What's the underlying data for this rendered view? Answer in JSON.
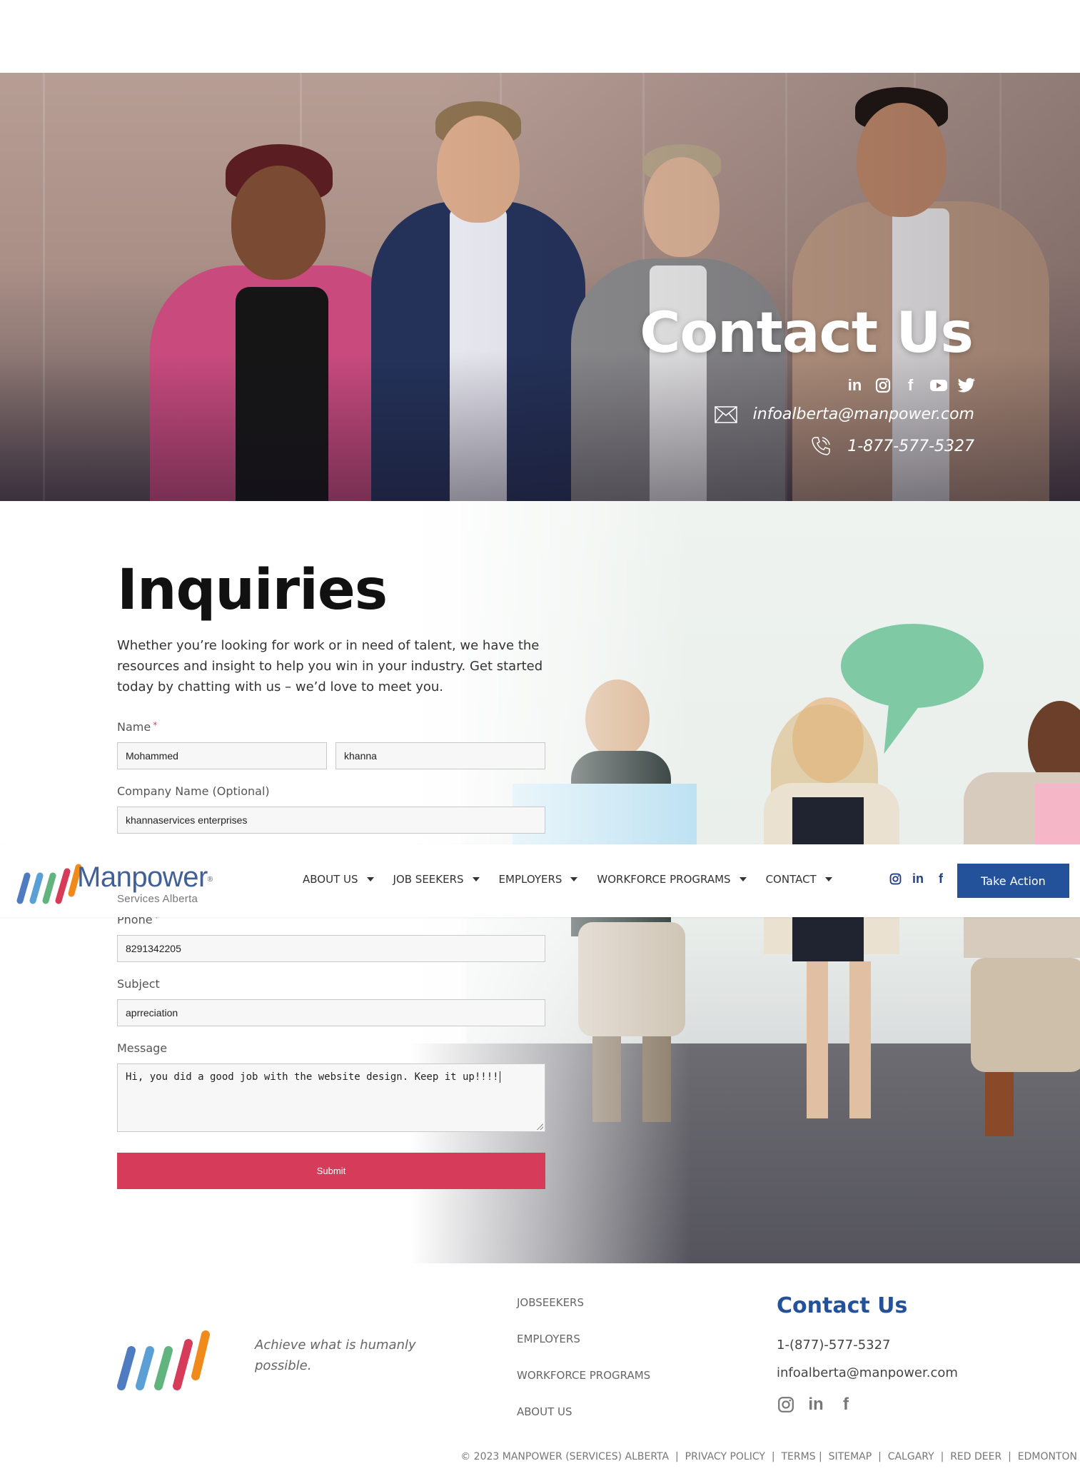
{
  "hero": {
    "title": "Contact Us",
    "social_icons": [
      "linkedin-icon",
      "instagram-icon",
      "facebook-icon",
      "youtube-icon",
      "twitter-icon"
    ],
    "email": "infoalberta@manpower.com",
    "phone": "1-877-577-5327"
  },
  "inquiries": {
    "title": "Inquiries",
    "intro": "Whether you’re looking for work or in need of talent, we have the resources and insight to help you win in your industry. Get started today by chatting with us – we’d love to meet you.",
    "name_label": "Name",
    "required_mark": "*",
    "first_name_value": "Mohammed",
    "last_name_value": "khanna",
    "company_label": "Company Name (Optional)",
    "company_value": "khannaservices enterprises",
    "phone_label": "Phone",
    "phone_value": "8291342205",
    "subject_label": "Subject",
    "subject_value": "aprreciation",
    "message_label": "Message",
    "message_value": "Hi, you did a good job with the website design. Keep it up!!!!",
    "submit_label": "Submit"
  },
  "nav": {
    "brand": "Manpower",
    "brand_sub": "Services Alberta",
    "items": [
      {
        "label": "ABOUT US"
      },
      {
        "label": "JOB SEEKERS"
      },
      {
        "label": "EMPLOYERS"
      },
      {
        "label": "WORKFORCE PROGRAMS"
      },
      {
        "label": "CONTACT"
      }
    ],
    "social_icons": [
      "instagram-icon",
      "linkedin-icon",
      "facebook-icon"
    ],
    "cta_label": "Take Action"
  },
  "footer": {
    "tagline": "Achieve what is humanly possible.",
    "links": [
      "JOBSEEKERS",
      "EMPLOYERS",
      "WORKFORCE PROGRAMS",
      "ABOUT US"
    ],
    "contact_title": "Contact Us",
    "phone": "1-(877)-577-5327",
    "email": "infoalberta@manpower.com",
    "social_icons": [
      "instagram-icon",
      "linkedin-icon",
      "facebook-icon"
    ],
    "bottom_links": [
      "© 2023 MANPOWER (SERVICES) ALBERTA",
      "PRIVACY POLICY",
      "TERMS",
      "SITEMAP",
      "CALGARY",
      "RED DEER",
      "EDMONTON"
    ],
    "bottom_separators": [
      "|",
      "|",
      "|",
      "|",
      "|",
      "|"
    ]
  },
  "colors": {
    "brand_blue": "#23519a",
    "submit_red": "#d63c5a",
    "logo_stripes": [
      "#4f7cc0",
      "#5aa0d4",
      "#62b47f",
      "#d63c5a",
      "#ef8a1b"
    ]
  }
}
